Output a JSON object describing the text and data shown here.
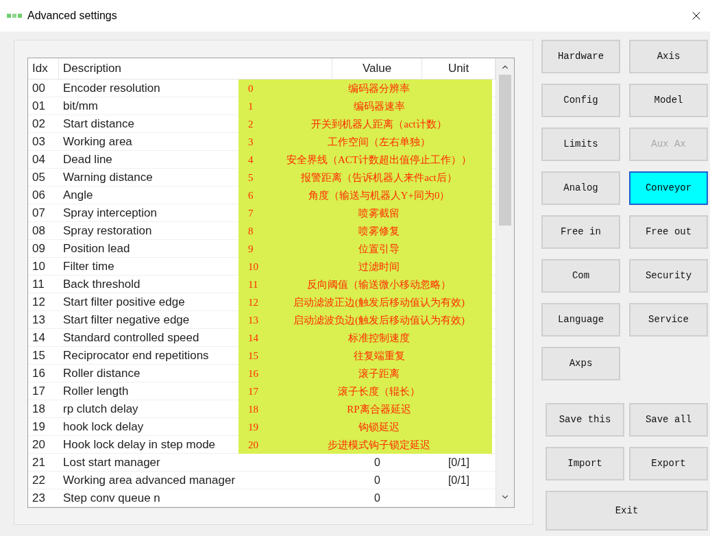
{
  "window": {
    "title": "Advanced settings"
  },
  "table": {
    "columns": [
      "Idx",
      "Description",
      "Value",
      "Unit"
    ],
    "rows": [
      {
        "idx": "00",
        "description": "Encoder resolution"
      },
      {
        "idx": "01",
        "description": "bit/mm"
      },
      {
        "idx": "02",
        "description": "Start distance"
      },
      {
        "idx": "03",
        "description": "Working area"
      },
      {
        "idx": "04",
        "description": "Dead line"
      },
      {
        "idx": "05",
        "description": "Warning distance"
      },
      {
        "idx": "06",
        "description": "Angle"
      },
      {
        "idx": "07",
        "description": "Spray interception"
      },
      {
        "idx": "08",
        "description": "Spray restoration"
      },
      {
        "idx": "09",
        "description": "Position lead"
      },
      {
        "idx": "10",
        "description": "Filter time"
      },
      {
        "idx": "11",
        "description": "Back threshold"
      },
      {
        "idx": "12",
        "description": "Start filter positive edge"
      },
      {
        "idx": "13",
        "description": "Start filter negative edge"
      },
      {
        "idx": "14",
        "description": "Standard controlled speed"
      },
      {
        "idx": "15",
        "description": "Reciprocator end repetitions"
      },
      {
        "idx": "16",
        "description": "Roller distance"
      },
      {
        "idx": "17",
        "description": "Roller length"
      },
      {
        "idx": "18",
        "description": "rp clutch delay"
      },
      {
        "idx": "19",
        "description": "hook lock delay"
      },
      {
        "idx": "20",
        "description": "Hook lock delay in step mode"
      },
      {
        "idx": "21",
        "description": "Lost start manager",
        "value": "0",
        "unit": "[0/1]"
      },
      {
        "idx": "22",
        "description": "Working area advanced manager",
        "value": "0",
        "unit": "[0/1]"
      },
      {
        "idx": "23",
        "description": "Step conv queue n",
        "value": "0"
      }
    ]
  },
  "annotation": {
    "rows": [
      {
        "number": "0",
        "text": "编码器分辨率"
      },
      {
        "number": "1",
        "text": "编码器速率"
      },
      {
        "number": "2",
        "text": "开关到机器人距离（act计数）"
      },
      {
        "number": "3",
        "text": "工作空间（左右单独）"
      },
      {
        "number": "4",
        "text": "安全界线（ACT计数超出值停止工作））"
      },
      {
        "number": "5",
        "text": "报警距离（告诉机器人来件act后）"
      },
      {
        "number": "6",
        "text": "角度（输送与机器人Y+同为0）"
      },
      {
        "number": "7",
        "text": "喷雾截留"
      },
      {
        "number": "8",
        "text": "喷雾修复"
      },
      {
        "number": "9",
        "text": "位置引导"
      },
      {
        "number": "10",
        "text": "过滤时间"
      },
      {
        "number": "11",
        "text": "反向阈值（输送微小移动忽略）"
      },
      {
        "number": "12",
        "text": "启动滤波正边(触发后移动值认为有效)"
      },
      {
        "number": "13",
        "text": "启动滤波负边(触发后移动值认为有效)"
      },
      {
        "number": "14",
        "text": "标准控制速度"
      },
      {
        "number": "15",
        "text": "往复端重复"
      },
      {
        "number": "16",
        "text": "滚子距离"
      },
      {
        "number": "17",
        "text": "滚子长度（辊长）"
      },
      {
        "number": "18",
        "text": "RP离合器延迟"
      },
      {
        "number": "19",
        "text": "钩锁延迟"
      },
      {
        "number": "20",
        "text": "步进模式钩子锁定延迟"
      }
    ]
  },
  "nav_buttons": [
    {
      "label": "Hardware",
      "selected": false,
      "disabled": false
    },
    {
      "label": "Axis",
      "selected": false,
      "disabled": false
    },
    {
      "label": "Config",
      "selected": false,
      "disabled": false
    },
    {
      "label": "Model",
      "selected": false,
      "disabled": false
    },
    {
      "label": "Limits",
      "selected": false,
      "disabled": false
    },
    {
      "label": "Aux Ax",
      "selected": false,
      "disabled": true
    },
    {
      "label": "Analog",
      "selected": false,
      "disabled": false
    },
    {
      "label": "Conveyor",
      "selected": true,
      "disabled": false
    },
    {
      "label": "Free in",
      "selected": false,
      "disabled": false
    },
    {
      "label": "Free out",
      "selected": false,
      "disabled": false
    },
    {
      "label": "Com",
      "selected": false,
      "disabled": false
    },
    {
      "label": "Security",
      "selected": false,
      "disabled": false
    },
    {
      "label": "Language",
      "selected": false,
      "disabled": false
    },
    {
      "label": "Service",
      "selected": false,
      "disabled": false
    },
    {
      "label": "Axps",
      "selected": false,
      "disabled": false
    }
  ],
  "action_buttons": [
    {
      "label": "Save this",
      "kind": "half"
    },
    {
      "label": "Save all",
      "kind": "half"
    },
    {
      "label": "Import",
      "kind": "half"
    },
    {
      "label": "Export",
      "kind": "half"
    },
    {
      "label": "Exit",
      "kind": "wide"
    }
  ]
}
